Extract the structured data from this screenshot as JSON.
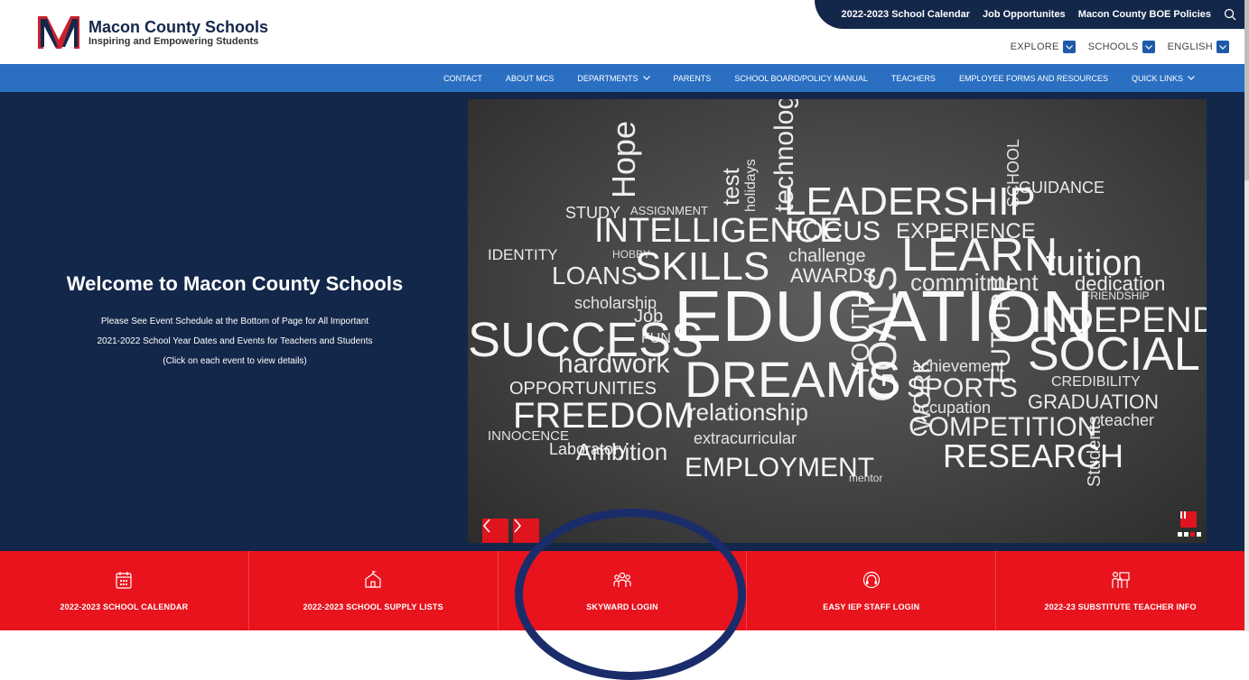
{
  "site": {
    "name": "Macon County Schools",
    "tagline": "Inspiring and Empowering Students",
    "logo_letter": "M"
  },
  "utility_links": [
    "2022-2023 School Calendar",
    "Job Opportunites",
    "Macon County BOE Policies"
  ],
  "dropdowns": [
    "EXPLORE",
    "SCHOOLS",
    "ENGLISH"
  ],
  "nav": [
    {
      "label": "CONTACT",
      "has_menu": false
    },
    {
      "label": "ABOUT MCS",
      "has_menu": false
    },
    {
      "label": "DEPARTMENTS",
      "has_menu": true
    },
    {
      "label": "PARENTS",
      "has_menu": false
    },
    {
      "label": "SCHOOL BOARD/POLICY MANUAL",
      "has_menu": false
    },
    {
      "label": "TEACHERS",
      "has_menu": false
    },
    {
      "label": "EMPLOYEE FORMS AND RESOURCES",
      "has_menu": false
    },
    {
      "label": "QUICK LINKS",
      "has_menu": true
    }
  ],
  "hero": {
    "title": "Welcome to Macon County Schools",
    "lines": [
      "Please See Event Schedule at the Bottom of Page for All Important",
      "2021-2022 School Year Dates and Events for Teachers and Students",
      "(Click on each event to view details)"
    ]
  },
  "wordcloud": {
    "words": [
      "Hope",
      "test",
      "holidays",
      "technology",
      "SCHOOL",
      "STUDY",
      "ASSIGNMENT",
      "LEADERSHIP",
      "GUIDANCE",
      "INTELLIGENCE",
      "FOCUS",
      "EXPERIENCE",
      "IDENTITY",
      "HOBBY",
      "challenge",
      "LEARN",
      "tuition",
      "LOANS",
      "SKILLS",
      "AWARDS",
      "commitment",
      "dedication",
      "scholarship",
      "EDUCATION",
      "FRIENDSHIP",
      "SUCCESS",
      "Job",
      "FUN",
      "INDEPENDENC",
      "SOCIAL",
      "hardwork",
      "DREAMS",
      "achievement",
      "OPPORTUNITIES",
      "SPORTS",
      "CREDIBILITY",
      "FREEDOM",
      "relationship",
      "occupation",
      "GRADUATION",
      "INNOCENCE",
      "Laboratory",
      "COMPETITION",
      "teacher",
      "extracurricular",
      "Ambition",
      "EMPLOYMENT",
      "RESEARCH",
      "FUTURE",
      "YOUTH",
      "GOALS",
      "WORK",
      "Students",
      "mentor"
    ]
  },
  "slider": {
    "slide_count": 4,
    "active_slide": 2
  },
  "quick_links": [
    {
      "label": "2022-2023 SCHOOL CALENDAR",
      "icon": "calendar-icon"
    },
    {
      "label": "2022-2023 SCHOOL SUPPLY LISTS",
      "icon": "school-building-icon"
    },
    {
      "label": "SKYWARD LOGIN",
      "icon": "people-group-icon"
    },
    {
      "label": "EASY IEP STAFF LOGIN",
      "icon": "headset-icon"
    },
    {
      "label": "2022-23 SUBSTITUTE TEACHER INFO",
      "icon": "teacher-board-icon"
    }
  ],
  "colors": {
    "navy": "#13274a",
    "nav_blue": "#2a6fc2",
    "brand_red": "#e8131c",
    "annotation_circle": "#1b2c6b"
  }
}
